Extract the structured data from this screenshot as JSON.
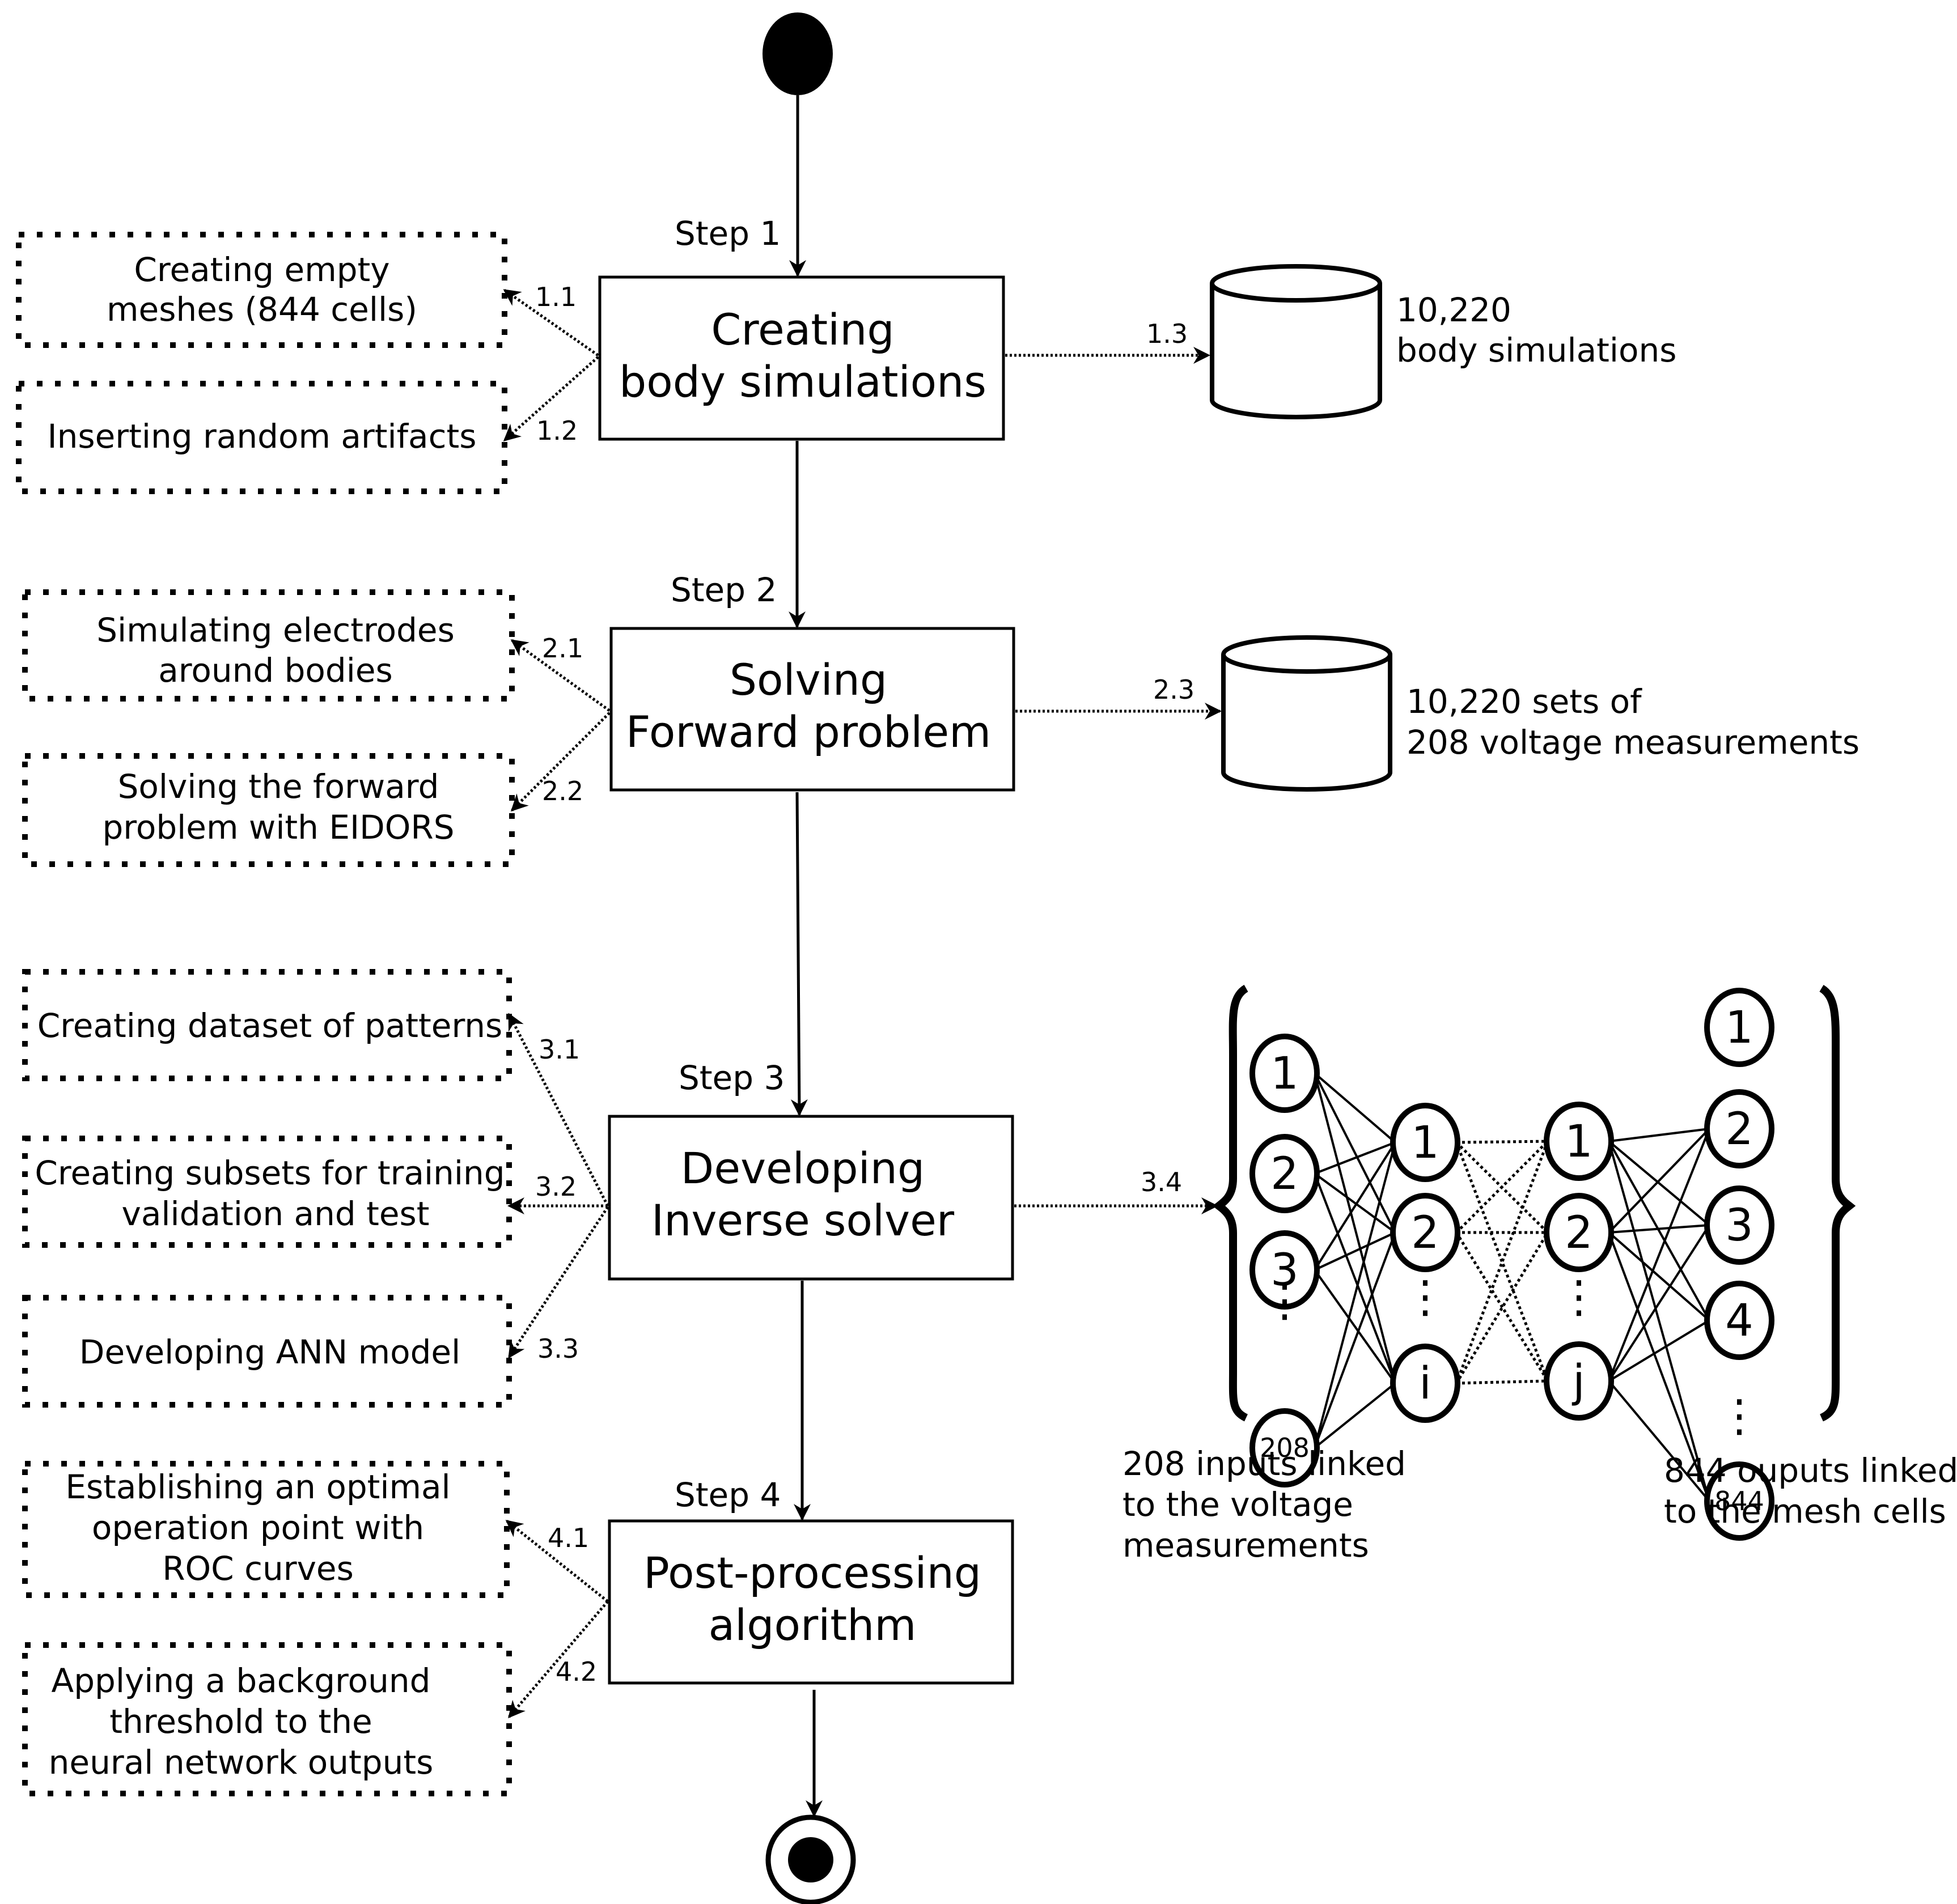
{
  "diagram": {
    "type": "activity-flowchart",
    "steps": [
      {
        "label": "Step 1",
        "title_lines": [
          "Creating",
          "body simulations"
        ],
        "subtasks": [
          {
            "id": "1.1",
            "lines": [
              "Creating empty",
              "meshes (844  cells)"
            ]
          },
          {
            "id": "1.2",
            "lines": [
              "Inserting random artifacts"
            ]
          }
        ],
        "output": {
          "id": "1.3",
          "lines": [
            "10,220",
            "body simulations"
          ]
        }
      },
      {
        "label": "Step 2",
        "title_lines": [
          "Solving",
          "Forward problem"
        ],
        "subtasks": [
          {
            "id": "2.1",
            "lines": [
              "Simulating electrodes",
              "around bodies"
            ]
          },
          {
            "id": "2.2",
            "lines": [
              "Solving the forward",
              "problem with EIDORS"
            ]
          }
        ],
        "output": {
          "id": "2.3",
          "lines": [
            "10,220 sets of",
            "208 voltage measurements"
          ]
        }
      },
      {
        "label": "Step 3",
        "title_lines": [
          "Developing",
          "Inverse solver"
        ],
        "subtasks": [
          {
            "id": "3.1",
            "lines": [
              "Creating dataset of patterns"
            ]
          },
          {
            "id": "3.2",
            "lines": [
              "Creating subsets for training",
              "validation and test"
            ]
          },
          {
            "id": "3.3",
            "lines": [
              "Developing ANN model"
            ]
          }
        ],
        "output": {
          "id": "3.4"
        }
      },
      {
        "label": "Step 4",
        "title_lines": [
          "Post-processing",
          "algorithm"
        ],
        "subtasks": [
          {
            "id": "4.1",
            "lines": [
              "Establishing an optimal",
              "operation point with",
              "ROC curves"
            ]
          },
          {
            "id": "4.2",
            "lines": [
              "Applying a background",
              "threshold to the",
              "neural network outputs"
            ]
          }
        ]
      }
    ],
    "network": {
      "input_nodes": [
        "1",
        "2",
        "3",
        "208"
      ],
      "hidden1_nodes": [
        "1",
        "2",
        "i"
      ],
      "hidden2_nodes": [
        "1",
        "2",
        "j"
      ],
      "output_nodes": [
        "1",
        "2",
        "3",
        "4",
        "844"
      ],
      "ellipsis": "⋮",
      "input_caption": [
        "208 inputs linked",
        "to the voltage",
        "measurements"
      ],
      "output_caption": [
        "844 ouputs linked",
        "to the mesh cells"
      ]
    },
    "start_node": "initial-state",
    "end_node": "final-state"
  }
}
